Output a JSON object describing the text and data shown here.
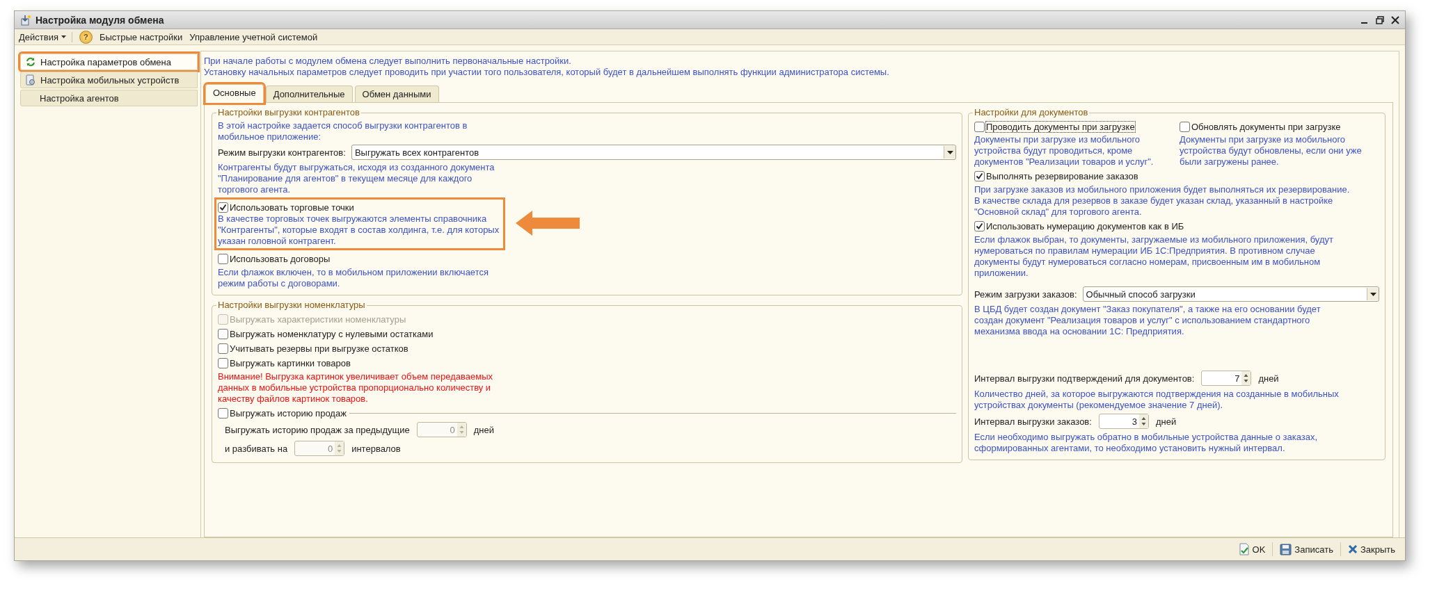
{
  "window": {
    "title": "Настройка модуля обмена"
  },
  "toolbar": [
    {
      "kind": "menu",
      "label": "Действия"
    },
    {
      "kind": "help",
      "label": "?"
    },
    {
      "kind": "link",
      "label": "Быстрые настройки"
    },
    {
      "kind": "link",
      "label": "Управление учетной системой"
    }
  ],
  "sidebar": {
    "items": [
      {
        "label": "Настройка параметров обмена",
        "selected": true,
        "highlighted": true
      },
      {
        "label": "Настройка мобильных устройств",
        "selected": false,
        "highlighted": false
      },
      {
        "label": "Настройка агентов",
        "selected": false,
        "highlighted": false
      }
    ]
  },
  "intro": [
    "При начале работы с модулем обмена следует выполнить первоначальные настройки.",
    "Установку начальных параметров следует проводить при участии того пользователя, который будет в дальнейшем выполнять функции администратора системы."
  ],
  "tabs": [
    {
      "label": "Основные",
      "selected": true,
      "highlighted": true
    },
    {
      "label": "Дополнительные",
      "selected": false,
      "highlighted": false
    },
    {
      "label": "Обмен данными",
      "selected": false,
      "highlighted": false
    }
  ],
  "panel": {
    "columns": [
      {
        "groups": [
          {
            "title": "Настройки выгрузки контрагентов",
            "rows": [
              {
                "kind": "note",
                "text": "В этой настройке задается способ выгрузки контрагентов в\nмобильное приложение:"
              },
              {
                "kind": "select",
                "label": "Режим выгрузки контрагентов:",
                "value": "Выгружать всех контрагентов"
              },
              {
                "kind": "note",
                "text": "Контрагенты будут выгружаться, исходя из созданного документа\n\"Планирование для агентов\" в текущем месяце для каждого\nторгового агента."
              },
              {
                "kind": "checkbox",
                "label": "Использовать торговые точки",
                "checked": true,
                "disabled": false,
                "highlighted": true,
                "arrow": true,
                "note": "В качестве торговых точек выгружаются элементы справочника\n\"Контрагенты\", которые входят в состав холдинга, т.е. для которых\nуказан головной контрагент."
              },
              {
                "kind": "checkbox",
                "label": "Использовать договоры",
                "checked": false,
                "disabled": false,
                "note": "Если флажок включен, то в мобильном приложении включается\nрежим работы с договорами."
              }
            ]
          },
          {
            "title": "Настройки выгрузки номенклатуры",
            "rows": [
              {
                "kind": "checkbox",
                "label": "Выгружать характеристики номенклатуры",
                "checked": false,
                "disabled": true
              },
              {
                "kind": "checkbox",
                "label": "Выгружать номенклатуру с нулевыми остатками",
                "checked": false,
                "disabled": false
              },
              {
                "kind": "checkbox",
                "label": "Учитывать резервы при выгрузке остатков",
                "checked": false,
                "disabled": false
              },
              {
                "kind": "checkbox",
                "label": "Выгружать картинки товаров",
                "checked": false,
                "disabled": false
              },
              {
                "kind": "warning",
                "text": "Внимание! Выгрузка картинок увеличивает объем передаваемых\nданных в мобильные устройства пропорционально количеству и\nкачеству файлов картинок товаров."
              },
              {
                "kind": "section_checkbox",
                "label": "Выгружать историю продаж",
                "checked": false
              },
              {
                "kind": "spin",
                "label": "Выгружать историю продаж за предыдущие",
                "value": "0",
                "unit": "дней",
                "disabled": true
              },
              {
                "kind": "spin",
                "label": "и разбивать на",
                "value": "0",
                "unit": "интервалов",
                "disabled": true
              }
            ]
          }
        ]
      },
      {
        "groups": [
          {
            "title": "Настройки для документов",
            "rows": [
              {
                "kind": "pair",
                "options": [
                  {
                    "label": "Проводить документы при загрузке",
                    "checked": false,
                    "focused": true,
                    "note": "Документы при загрузке из мобильного\nустройства будут проводиться, кроме\nдокументов \"Реализации товаров и услуг\"."
                  },
                  {
                    "label": "Обновлять документы при загрузке",
                    "checked": false,
                    "focused": false,
                    "note": "Документы при загрузке из мобильного\nустройства будут обновлены, если они уже\nбыли загружены ранее."
                  }
                ]
              },
              {
                "kind": "checkbox",
                "label": "Выполнять резервирование заказов",
                "checked": true,
                "disabled": false,
                "note": "При загрузке заказов из мобильного приложения будет выполняться их резервирование.\nВ качестве склада для резервов в заказе будет указан склад, указанный в настройке\n\"Основной склад\" для торгового агента."
              },
              {
                "kind": "checkbox",
                "label": "Использовать нумерацию документов как в ИБ",
                "checked": true,
                "disabled": false,
                "note": "Если флажок выбран, то документы, загружаемые из мобильного приложения, будут\nнумероваться по правилам нумерации ИБ 1С:Предприятия.  В противном случае\nдокументы будут нумероваться согласно номерам, присвоенным им в мобильном\nприложении."
              },
              {
                "kind": "select",
                "label": "Режим загрузки заказов:",
                "value": "Обычный способ загрузки"
              },
              {
                "kind": "note",
                "text": "В ЦБД будет создан документ \"Заказ покупателя\", а также на его основании будет\nсоздан документ \"Реализация товаров и услуг\" с использованием стандартного\nмеханизма ввода на основании 1С: Предприятия."
              },
              {
                "kind": "spin",
                "label": "Интервал выгрузки подтверждений для документов:",
                "value": "7",
                "unit": "дней",
                "disabled": false
              },
              {
                "kind": "note",
                "text": "Количество дней, за которое выгружаются подтверждения на созданные в мобильных\nустройствах документы (рекомендуемое значение 7 дней)."
              },
              {
                "kind": "spin",
                "label": "Интервал выгрузки заказов:",
                "value": "3",
                "unit": "дней",
                "disabled": false
              },
              {
                "kind": "note",
                "text": "Если необходимо выгружать обратно в мобильные устройства данные о заказах,\nсформированных агентами, то необходимо установить нужный интервал."
              }
            ]
          }
        ]
      }
    ]
  },
  "footer": [
    {
      "label": "OK"
    },
    {
      "label": "Записать"
    },
    {
      "label": "Закрыть"
    }
  ]
}
